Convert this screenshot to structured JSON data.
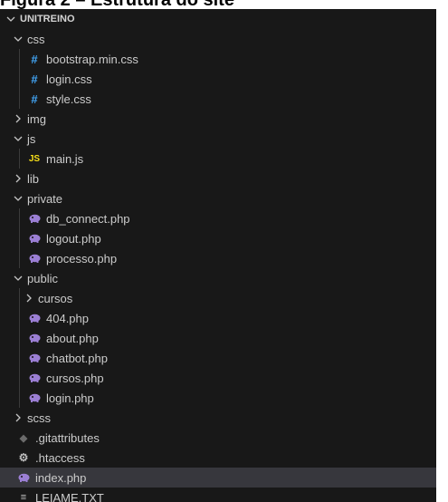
{
  "caption": "Figura 2 – Estrutura do site",
  "root_label": "UNITREINO",
  "tree": [
    {
      "label": "css",
      "icon": "folder",
      "expanded": true,
      "depth": 1
    },
    {
      "label": "bootstrap.min.css",
      "icon": "css-file-icon",
      "depth": 2
    },
    {
      "label": "login.css",
      "icon": "css-file-icon",
      "depth": 2
    },
    {
      "label": "style.css",
      "icon": "css-file-icon",
      "depth": 2
    },
    {
      "label": "img",
      "icon": "folder",
      "expanded": false,
      "depth": 1
    },
    {
      "label": "js",
      "icon": "folder",
      "expanded": true,
      "depth": 1
    },
    {
      "label": "main.js",
      "icon": "js-file-icon",
      "depth": 2
    },
    {
      "label": "lib",
      "icon": "folder",
      "expanded": false,
      "depth": 1
    },
    {
      "label": "private",
      "icon": "folder",
      "expanded": true,
      "depth": 1
    },
    {
      "label": "db_connect.php",
      "icon": "php-file-icon",
      "depth": 2
    },
    {
      "label": "logout.php",
      "icon": "php-file-icon",
      "depth": 2
    },
    {
      "label": "processo.php",
      "icon": "php-file-icon",
      "depth": 2
    },
    {
      "label": "public",
      "icon": "folder",
      "expanded": true,
      "depth": 1
    },
    {
      "label": "cursos",
      "icon": "folder",
      "expanded": false,
      "depth": 2
    },
    {
      "label": "404.php",
      "icon": "php-file-icon",
      "depth": 2
    },
    {
      "label": "about.php",
      "icon": "php-file-icon",
      "depth": 2
    },
    {
      "label": "chatbot.php",
      "icon": "php-file-icon",
      "depth": 2
    },
    {
      "label": "cursos.php",
      "icon": "php-file-icon",
      "depth": 2
    },
    {
      "label": "login.php",
      "icon": "php-file-icon",
      "depth": 2
    },
    {
      "label": "scss",
      "icon": "folder",
      "expanded": false,
      "depth": 1
    },
    {
      "label": ".gitattributes",
      "icon": "git-file-icon",
      "depth": 1
    },
    {
      "label": ".htaccess",
      "icon": "gear-icon",
      "depth": 1
    },
    {
      "label": "index.php",
      "icon": "php-file-icon",
      "depth": 1,
      "active": true
    },
    {
      "label": "LEIAME.TXT",
      "icon": "text-file-icon",
      "depth": 1
    }
  ],
  "colors": {
    "panel": "#181818",
    "active_row": "#37373d",
    "css": "#42a5f5",
    "js": "#f5de19",
    "php": "#9b7fd4"
  }
}
